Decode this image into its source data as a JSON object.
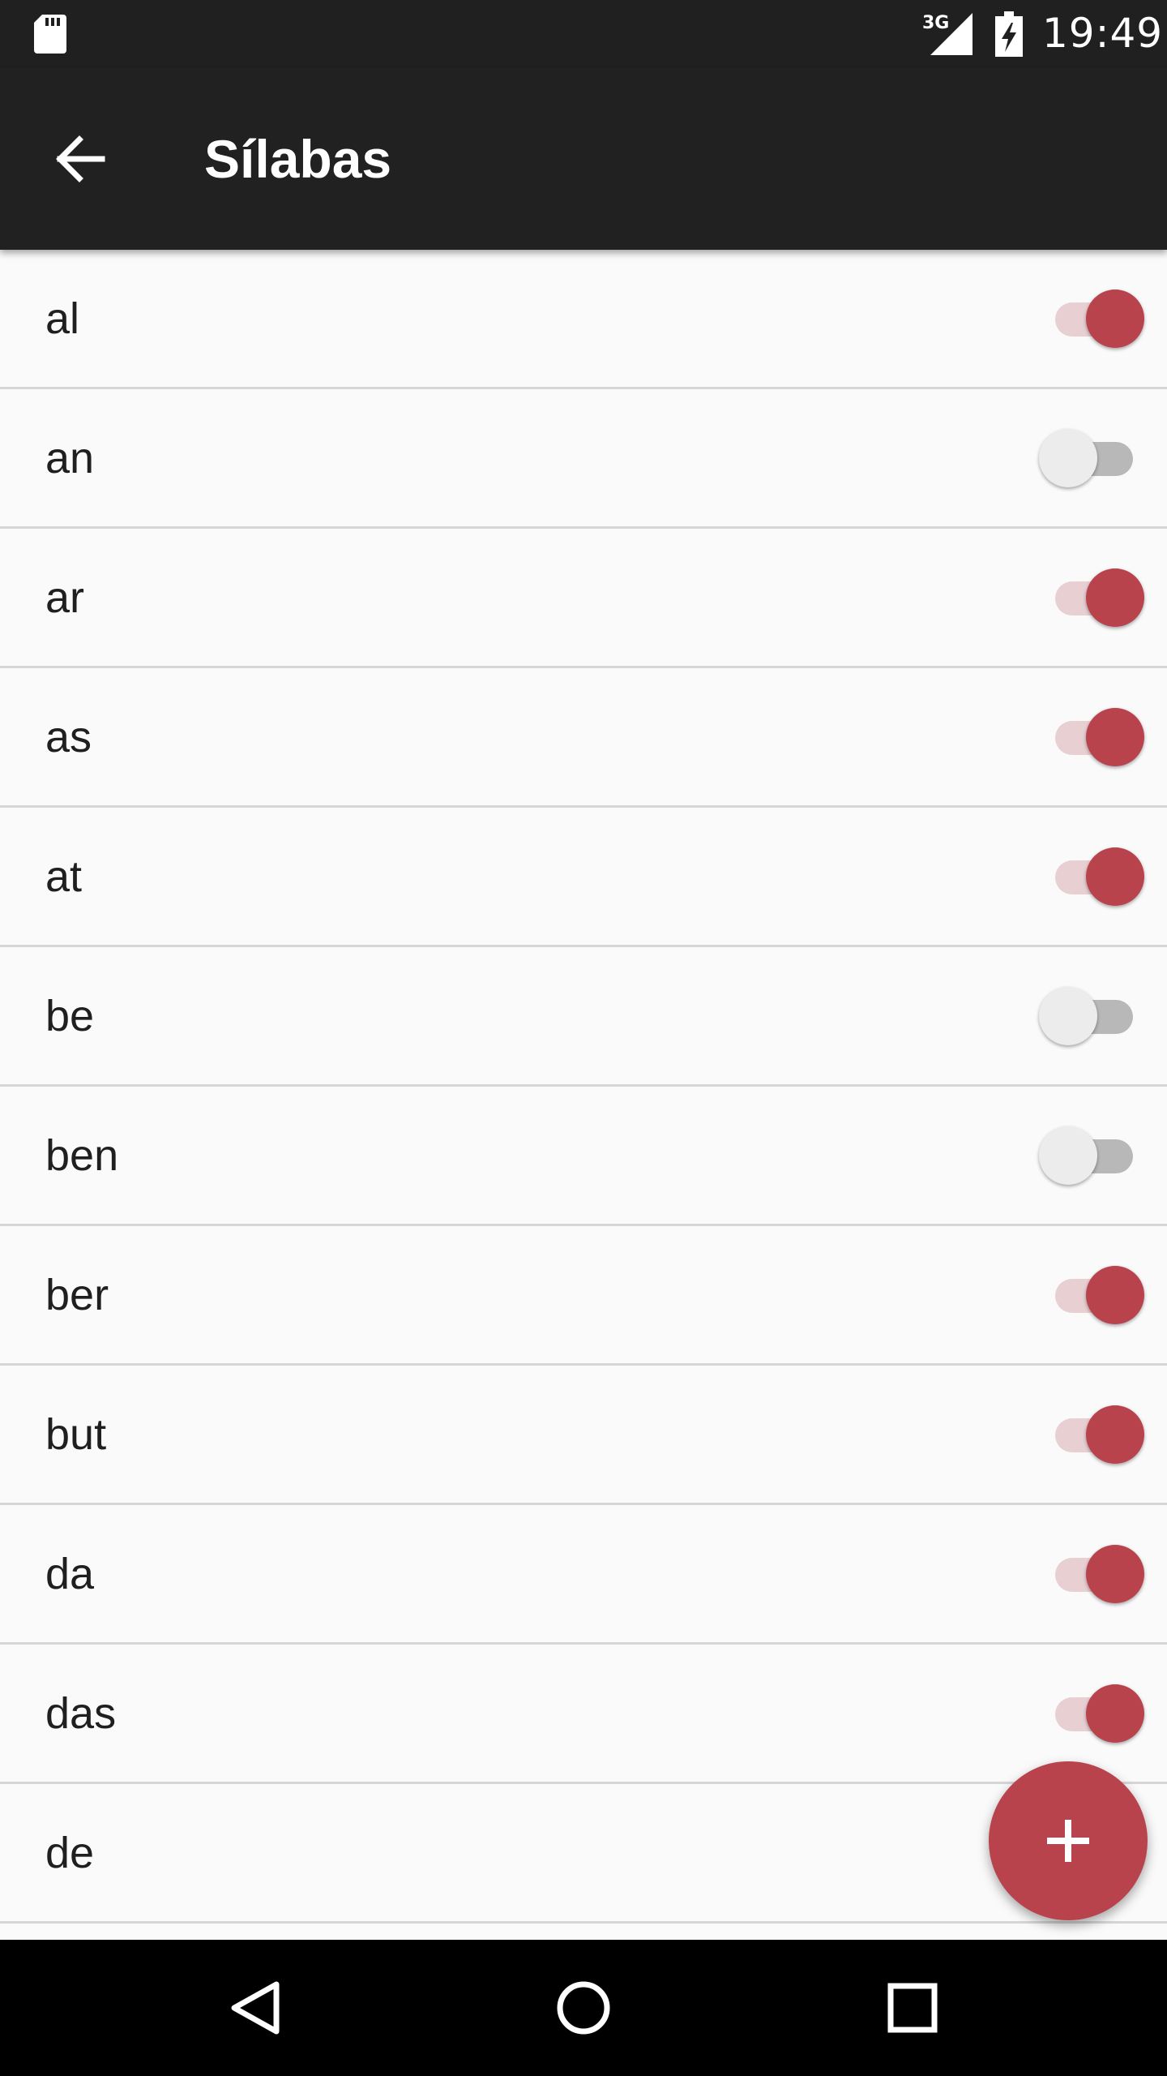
{
  "status_bar": {
    "network": "3G",
    "time": "19:49",
    "icons": [
      "sd-card-icon",
      "signal-icon",
      "battery-charging-icon"
    ]
  },
  "toolbar": {
    "title": "Sílabas",
    "back_icon": "arrow-left-icon"
  },
  "items": [
    {
      "label": "al",
      "enabled": true
    },
    {
      "label": "an",
      "enabled": false
    },
    {
      "label": "ar",
      "enabled": true
    },
    {
      "label": "as",
      "enabled": true
    },
    {
      "label": "at",
      "enabled": true
    },
    {
      "label": "be",
      "enabled": false
    },
    {
      "label": "ben",
      "enabled": false
    },
    {
      "label": "ber",
      "enabled": true
    },
    {
      "label": "but",
      "enabled": true
    },
    {
      "label": "da",
      "enabled": true
    },
    {
      "label": "das",
      "enabled": true
    },
    {
      "label": "de",
      "enabled": true
    }
  ],
  "fab": {
    "icon": "plus-icon"
  },
  "nav_bar": {
    "icons": [
      "back-triangle-icon",
      "home-circle-icon",
      "recents-square-icon"
    ]
  },
  "colors": {
    "accent": "#b9434d",
    "accent_track": "#e8cfd2",
    "toolbar": "#212121",
    "status_bar": "#202020",
    "background": "#fafafa"
  }
}
